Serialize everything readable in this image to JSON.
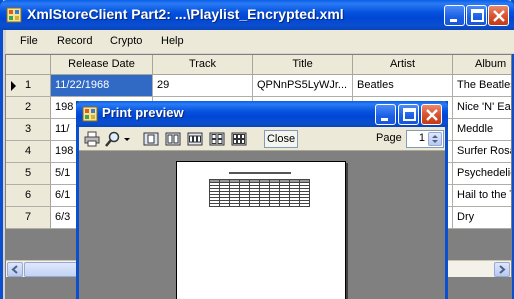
{
  "main_window": {
    "title": "XmlStoreClient Part2: ...\\Playlist_Encrypted.xml",
    "menu": [
      "File",
      "Record",
      "Crypto",
      "Help"
    ]
  },
  "grid": {
    "columns": [
      "Release Date",
      "Track",
      "Title",
      "Artist",
      "Album"
    ],
    "rows": [
      {
        "num": "1",
        "cells": [
          "11/22/1968",
          "29",
          "QPNnPS5LyWJr...",
          "Beatles",
          "The Beatles"
        ]
      },
      {
        "num": "2",
        "cells": [
          "198",
          "",
          "",
          "",
          "Nice 'N' Eas"
        ]
      },
      {
        "num": "3",
        "cells": [
          "11/",
          "",
          "",
          "",
          "Meddle"
        ]
      },
      {
        "num": "4",
        "cells": [
          "198",
          "",
          "",
          "",
          "Surfer Rosa"
        ]
      },
      {
        "num": "5",
        "cells": [
          "5/1",
          "",
          "",
          "",
          "Psychedelic"
        ]
      },
      {
        "num": "6",
        "cells": [
          "6/1",
          "",
          "",
          "",
          "Hail to the T"
        ]
      },
      {
        "num": "7",
        "cells": [
          "6/3",
          "",
          "",
          "",
          "Dry"
        ]
      }
    ],
    "selected_row": 0
  },
  "print_preview": {
    "title": "Print preview",
    "close_label": "Close",
    "page_label": "Page",
    "page_value": "1",
    "toolbar_icons": [
      "printer-icon",
      "zoom-icon",
      "one-page-icon",
      "two-pages-icon",
      "three-pages-icon",
      "four-pages-icon",
      "six-pages-icon"
    ]
  },
  "colors": {
    "titlebar": "#0a4fcf",
    "selection": "#316ac5",
    "close_button": "#d8502c"
  }
}
